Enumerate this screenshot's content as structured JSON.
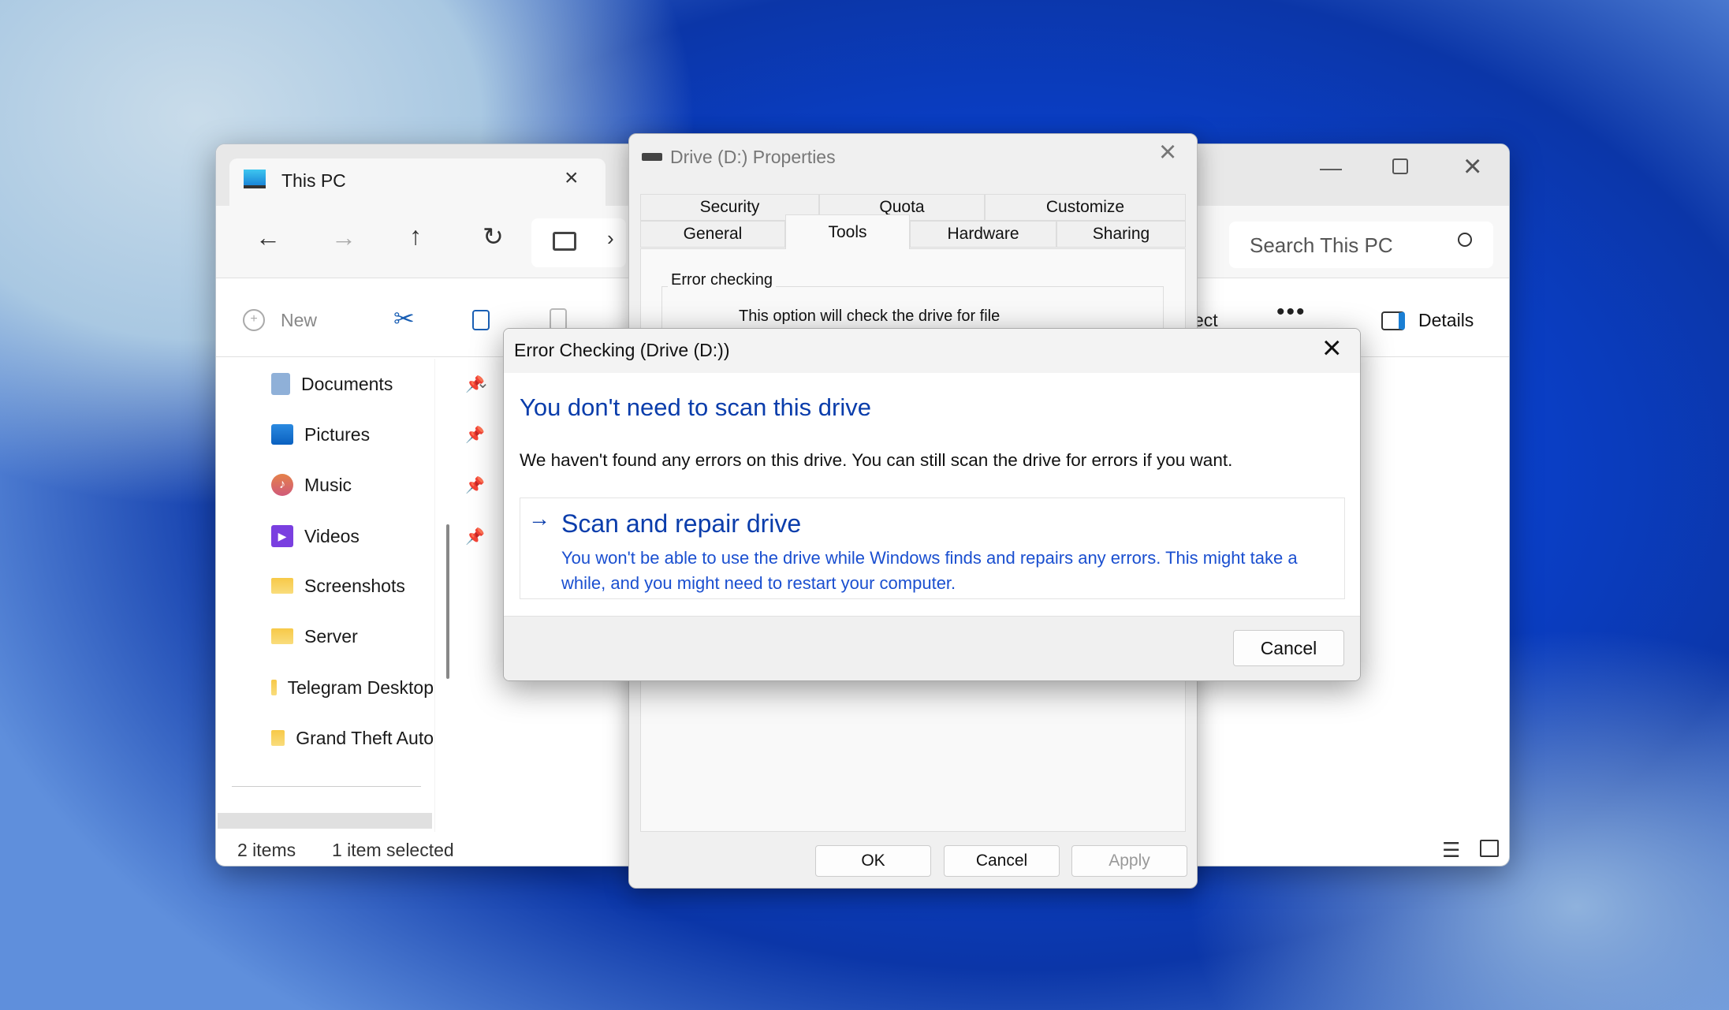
{
  "explorer": {
    "tab_title": "This PC",
    "search_placeholder": "Search This PC",
    "toolbar": {
      "new_label": "New",
      "select_partial": "ect",
      "details_label": "Details"
    },
    "sidebar": [
      {
        "label": "Documents",
        "icon": "documents-icon",
        "pinned": true
      },
      {
        "label": "Pictures",
        "icon": "pictures-icon",
        "pinned": true
      },
      {
        "label": "Music",
        "icon": "music-icon",
        "pinned": true
      },
      {
        "label": "Videos",
        "icon": "videos-icon",
        "pinned": true
      },
      {
        "label": "Screenshots",
        "icon": "folder-icon"
      },
      {
        "label": "Server",
        "icon": "folder-icon"
      },
      {
        "label": "Telegram Desktop",
        "icon": "folder-icon"
      },
      {
        "label": "Grand Theft Auto",
        "icon": "folder-icon"
      }
    ],
    "status": {
      "items": "2 items",
      "selected": "1 item selected"
    }
  },
  "properties": {
    "title": "Drive (D:) Properties",
    "tabs_row1": [
      "Security",
      "Quota",
      "Customize"
    ],
    "tabs_row2": [
      "General",
      "Tools",
      "Hardware",
      "Sharing"
    ],
    "active_tab": "Tools",
    "group_label": "Error checking",
    "group_text": "This option will check the drive for file",
    "buttons": {
      "ok": "OK",
      "cancel": "Cancel",
      "apply": "Apply"
    }
  },
  "error_dialog": {
    "title": "Error Checking (Drive (D:))",
    "heading": "You don't need to scan this drive",
    "body": "We haven't found any errors on this drive. You can still scan the drive for errors if you want.",
    "action_title": "Scan and repair drive",
    "action_desc": "You won't be able to use the drive while Windows finds and repairs any errors. This might take a while, and you might need to restart your computer.",
    "cancel": "Cancel",
    "accent": "#0a3dab"
  }
}
